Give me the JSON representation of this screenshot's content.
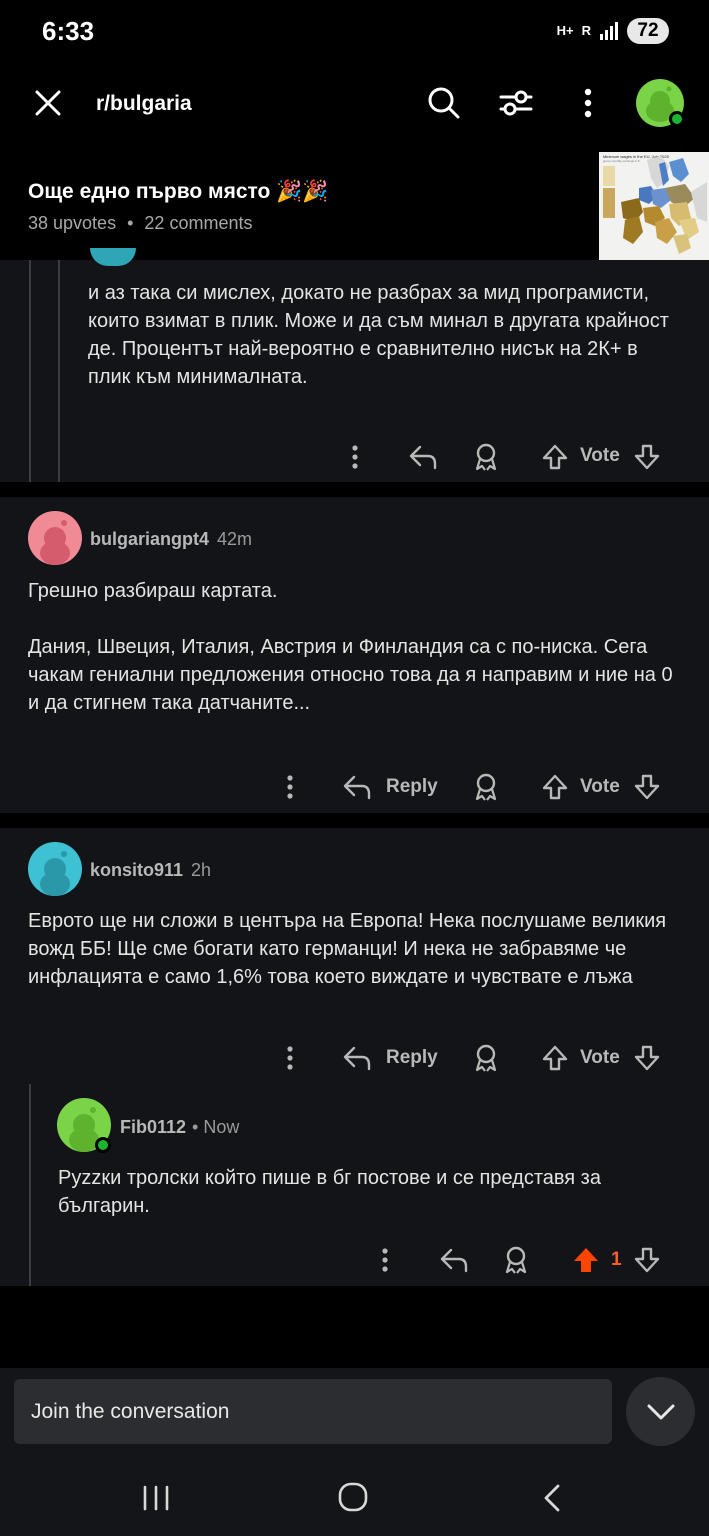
{
  "status_bar": {
    "time": "6:33",
    "network_label_1": "H+",
    "network_label_2": "R",
    "battery": "72"
  },
  "top_bar": {
    "subreddit": "r/bulgaria"
  },
  "post": {
    "title": "Още едно първо място 🎉🎉",
    "upvotes": "38 upvotes",
    "separator": "•",
    "comments": "22 comments",
    "thumbnail_title": "Minimum wages in the EU, July 2025",
    "thumbnail_subtitle": "gross monthly earnings in €"
  },
  "comments": [
    {
      "body": "и аз така си мислех, докато не разбрах за мид програмисти, които взимат в плик. Може и да съм минал в другата крайност де. Процентът най-вероятно е сравнително нисък на 2К+ в плик към минималната.",
      "vote_label": "Vote"
    },
    {
      "author": "bulgariangpt4",
      "time": "42m",
      "body": "Грешно разбираш картата.\n\nДания, Швеция, Италия, Австрия и Финландия са с по-ниска. Сега чакам гениални предложения относно това да я направим и ние на 0 и да стигнем така датчаните...",
      "reply_label": "Reply",
      "vote_label": "Vote",
      "avatar_color": "#f08a94"
    },
    {
      "author": "konsito911",
      "time": "2h",
      "body": "Еврото ще ни сложи в центъра на Европа! Нека послушаме великия вожд ББ! Ще сме богати като германци! И нека не забравяме че инфлацията е само 1,6% това което виждате и чувствате е лъжа",
      "reply_label": "Reply",
      "vote_label": "Vote",
      "avatar_color": "#3fc1d4"
    },
    {
      "author": "Fib0112",
      "time": "• Now",
      "body": "Руzzки тролски който пише в бг постове и се представя за българин.",
      "vote_count": "1",
      "avatar_color": "#7bd348"
    }
  ],
  "composer": {
    "placeholder": "Join the conversation"
  },
  "colors": {
    "background": "#000000",
    "card": "#121418",
    "upvote_active": "#ff4500",
    "online": "#1db530"
  }
}
